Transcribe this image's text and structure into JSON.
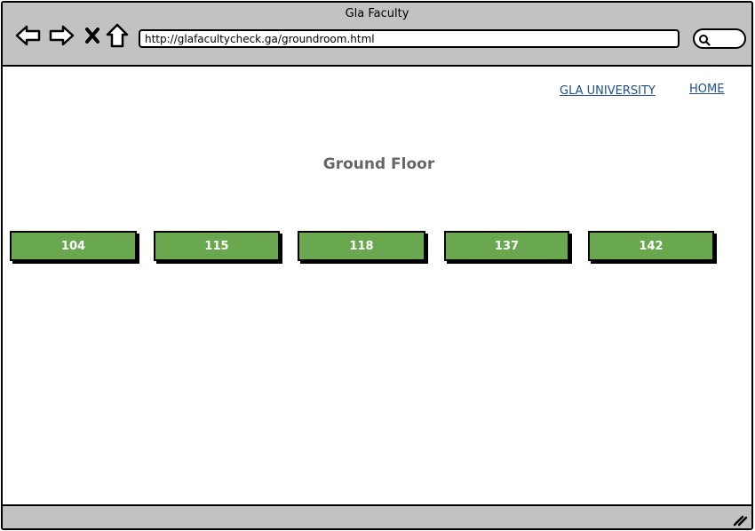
{
  "window": {
    "title": "Gla Faculty"
  },
  "toolbar": {
    "back_icon": "back-arrow-icon",
    "forward_icon": "forward-arrow-icon",
    "close_icon": "close-icon",
    "home_icon": "home-icon",
    "url": "http://glafacultycheck.ga/groundroom.html",
    "search_icon": "search-icon"
  },
  "nav": {
    "university_link": "GLA UNIVERSITY",
    "home_link": "HOME"
  },
  "main": {
    "title": "Ground Floor",
    "rooms": [
      "104",
      "115",
      "118",
      "137",
      "142"
    ]
  },
  "colors": {
    "chrome": "#c2c2c2",
    "room_button": "#6aa84f",
    "link": "#1f4e8c",
    "heading": "#666666"
  }
}
